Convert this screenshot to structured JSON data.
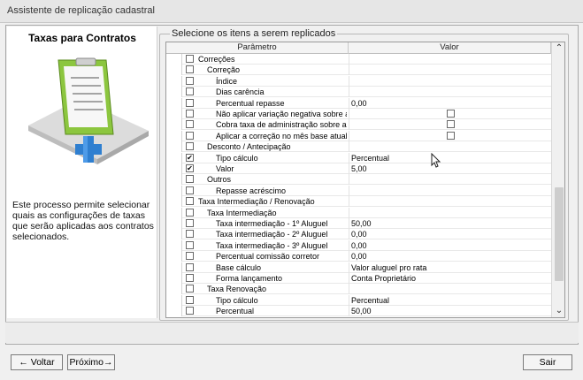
{
  "window": {
    "title": "Assistente de replicação cadastral"
  },
  "left_panel": {
    "title": "Taxas para Contratos",
    "description": "Este processo permite selecionar quais as configurações de taxas que serão aplicadas aos contratos selecionados."
  },
  "group": {
    "legend": "Selecione os itens a serem replicados"
  },
  "grid": {
    "columns": [
      "Parâmetro",
      "Valor"
    ],
    "rows": [
      {
        "label": "Correções",
        "value": "",
        "level": 1,
        "checked": false,
        "value_checkbox": false
      },
      {
        "label": "Correção",
        "value": "",
        "level": 2,
        "checked": false,
        "value_checkbox": false
      },
      {
        "label": "Índice",
        "value": "",
        "level": 3,
        "checked": false,
        "value_checkbox": false
      },
      {
        "label": "Dias carência",
        "value": "",
        "level": 3,
        "checked": false,
        "value_checkbox": false
      },
      {
        "label": "Percentual repasse",
        "value": "0,00",
        "level": 3,
        "checked": false,
        "value_checkbox": false
      },
      {
        "label": "Não aplicar variação negativa sobre a cor",
        "value": "",
        "level": 3,
        "checked": false,
        "value_checkbox": true
      },
      {
        "label": "Cobra taxa de administração sobre a corr",
        "value": "",
        "level": 3,
        "checked": false,
        "value_checkbox": true
      },
      {
        "label": "Aplicar a correção no mês base atual",
        "value": "",
        "level": 3,
        "checked": false,
        "value_checkbox": true
      },
      {
        "label": "Desconto / Antecipação",
        "value": "",
        "level": 2,
        "checked": false,
        "value_checkbox": false
      },
      {
        "label": "Tipo cálculo",
        "value": "Percentual",
        "level": 3,
        "checked": true,
        "value_checkbox": false
      },
      {
        "label": "Valor",
        "value": "5,00",
        "level": 3,
        "checked": true,
        "value_checkbox": false
      },
      {
        "label": "Outros",
        "value": "",
        "level": 2,
        "checked": false,
        "value_checkbox": false
      },
      {
        "label": "Repasse acréscimo",
        "value": "",
        "level": 3,
        "checked": false,
        "value_checkbox": false
      },
      {
        "label": "Taxa Intermediação / Renovação",
        "value": "",
        "level": 1,
        "checked": false,
        "value_checkbox": false
      },
      {
        "label": "Taxa Intermediação",
        "value": "",
        "level": 2,
        "checked": false,
        "value_checkbox": false
      },
      {
        "label": "Taxa intermediação - 1º Aluguel",
        "value": "50,00",
        "level": 3,
        "checked": false,
        "value_checkbox": false
      },
      {
        "label": "Taxa intermediação - 2º Aluguel",
        "value": "0,00",
        "level": 3,
        "checked": false,
        "value_checkbox": false
      },
      {
        "label": "Taxa intermediação - 3º Aluguel",
        "value": "0,00",
        "level": 3,
        "checked": false,
        "value_checkbox": false
      },
      {
        "label": "Percentual comissão corretor",
        "value": "0,00",
        "level": 3,
        "checked": false,
        "value_checkbox": false
      },
      {
        "label": "Base cálculo",
        "value": "Valor aluguel pro rata",
        "level": 3,
        "checked": false,
        "value_checkbox": false
      },
      {
        "label": "Forma lançamento",
        "value": "Conta Proprietário",
        "level": 3,
        "checked": false,
        "value_checkbox": false
      },
      {
        "label": "Taxa Renovação",
        "value": "",
        "level": 2,
        "checked": false,
        "value_checkbox": false
      },
      {
        "label": "Tipo cálculo",
        "value": "Percentual",
        "level": 3,
        "checked": false,
        "value_checkbox": false
      },
      {
        "label": "Percentual",
        "value": "50,00",
        "level": 3,
        "checked": false,
        "value_checkbox": false
      }
    ]
  },
  "buttons": {
    "back": "← Voltar",
    "next": "Próximo→",
    "exit": "Sair"
  },
  "icons": {
    "scroll_up": "chevron-up-icon",
    "scroll_down": "chevron-down-icon"
  },
  "colors": {
    "accent_blue": "#2f7fd0",
    "doc_green": "#8cc63f"
  }
}
